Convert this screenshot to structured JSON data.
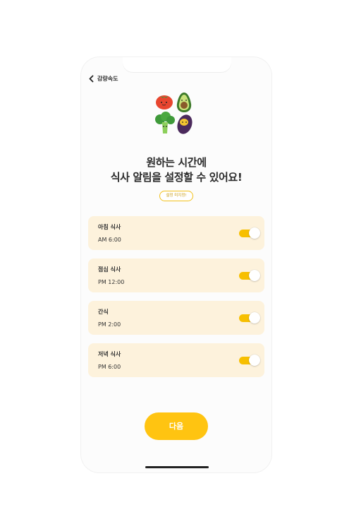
{
  "header": {
    "back_label": "감량속도"
  },
  "headline": {
    "line1": "원하는 시간에",
    "line2": "식사 알림을 설정할 수 있어요!"
  },
  "skip_label": "설정 미지정!",
  "meals": [
    {
      "label": "아침 식사",
      "time": "AM 6:00",
      "enabled": true
    },
    {
      "label": "점심 식사",
      "time": "PM 12:00",
      "enabled": true
    },
    {
      "label": "간식",
      "time": "PM 2:00",
      "enabled": true
    },
    {
      "label": "저녁 식사",
      "time": "PM 6:00",
      "enabled": true
    }
  ],
  "next_label": "다음",
  "colors": {
    "accent": "#ffc411",
    "card_bg": "#fdf2dc",
    "toggle_on": "#f7bf00"
  },
  "icons": [
    "chevron-left-icon",
    "tomato-icon",
    "avocado-icon",
    "broccoli-icon",
    "sweet-potato-icon"
  ]
}
